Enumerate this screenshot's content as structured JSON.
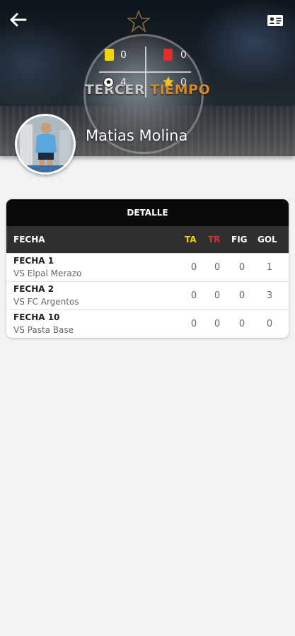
{
  "header": {
    "logo": {
      "word1": "TERCER",
      "word2": "TIEMPO"
    },
    "player_name": "Matias Molina",
    "stats": {
      "yellow_cards": "0",
      "red_cards": "0",
      "goals": "4",
      "figure": "0"
    },
    "colors": {
      "yellow": "#f2d40a",
      "red": "#e52b2b",
      "logo_orange": "#d98a25"
    }
  },
  "icons": [
    "back-arrow-icon",
    "id-card-icon",
    "star-icon",
    "yellow-card-icon",
    "red-card-icon",
    "soccer-ball-icon"
  ],
  "detail": {
    "title": "DETALLE",
    "columns": {
      "fecha": "FECHA",
      "ta": "TA",
      "tr": "TR",
      "fig": "FIG",
      "gol": "GOL"
    },
    "rows": [
      {
        "fecha": "FECHA 1",
        "rival": "VS Elpal Merazo",
        "ta": "0",
        "tr": "0",
        "fig": "0",
        "gol": "1"
      },
      {
        "fecha": "FECHA 2",
        "rival": "VS FC Argentos",
        "ta": "0",
        "tr": "0",
        "fig": "0",
        "gol": "3"
      },
      {
        "fecha": "FECHA 10",
        "rival": "VS Pasta Base",
        "ta": "0",
        "tr": "0",
        "fig": "0",
        "gol": "0"
      }
    ]
  }
}
